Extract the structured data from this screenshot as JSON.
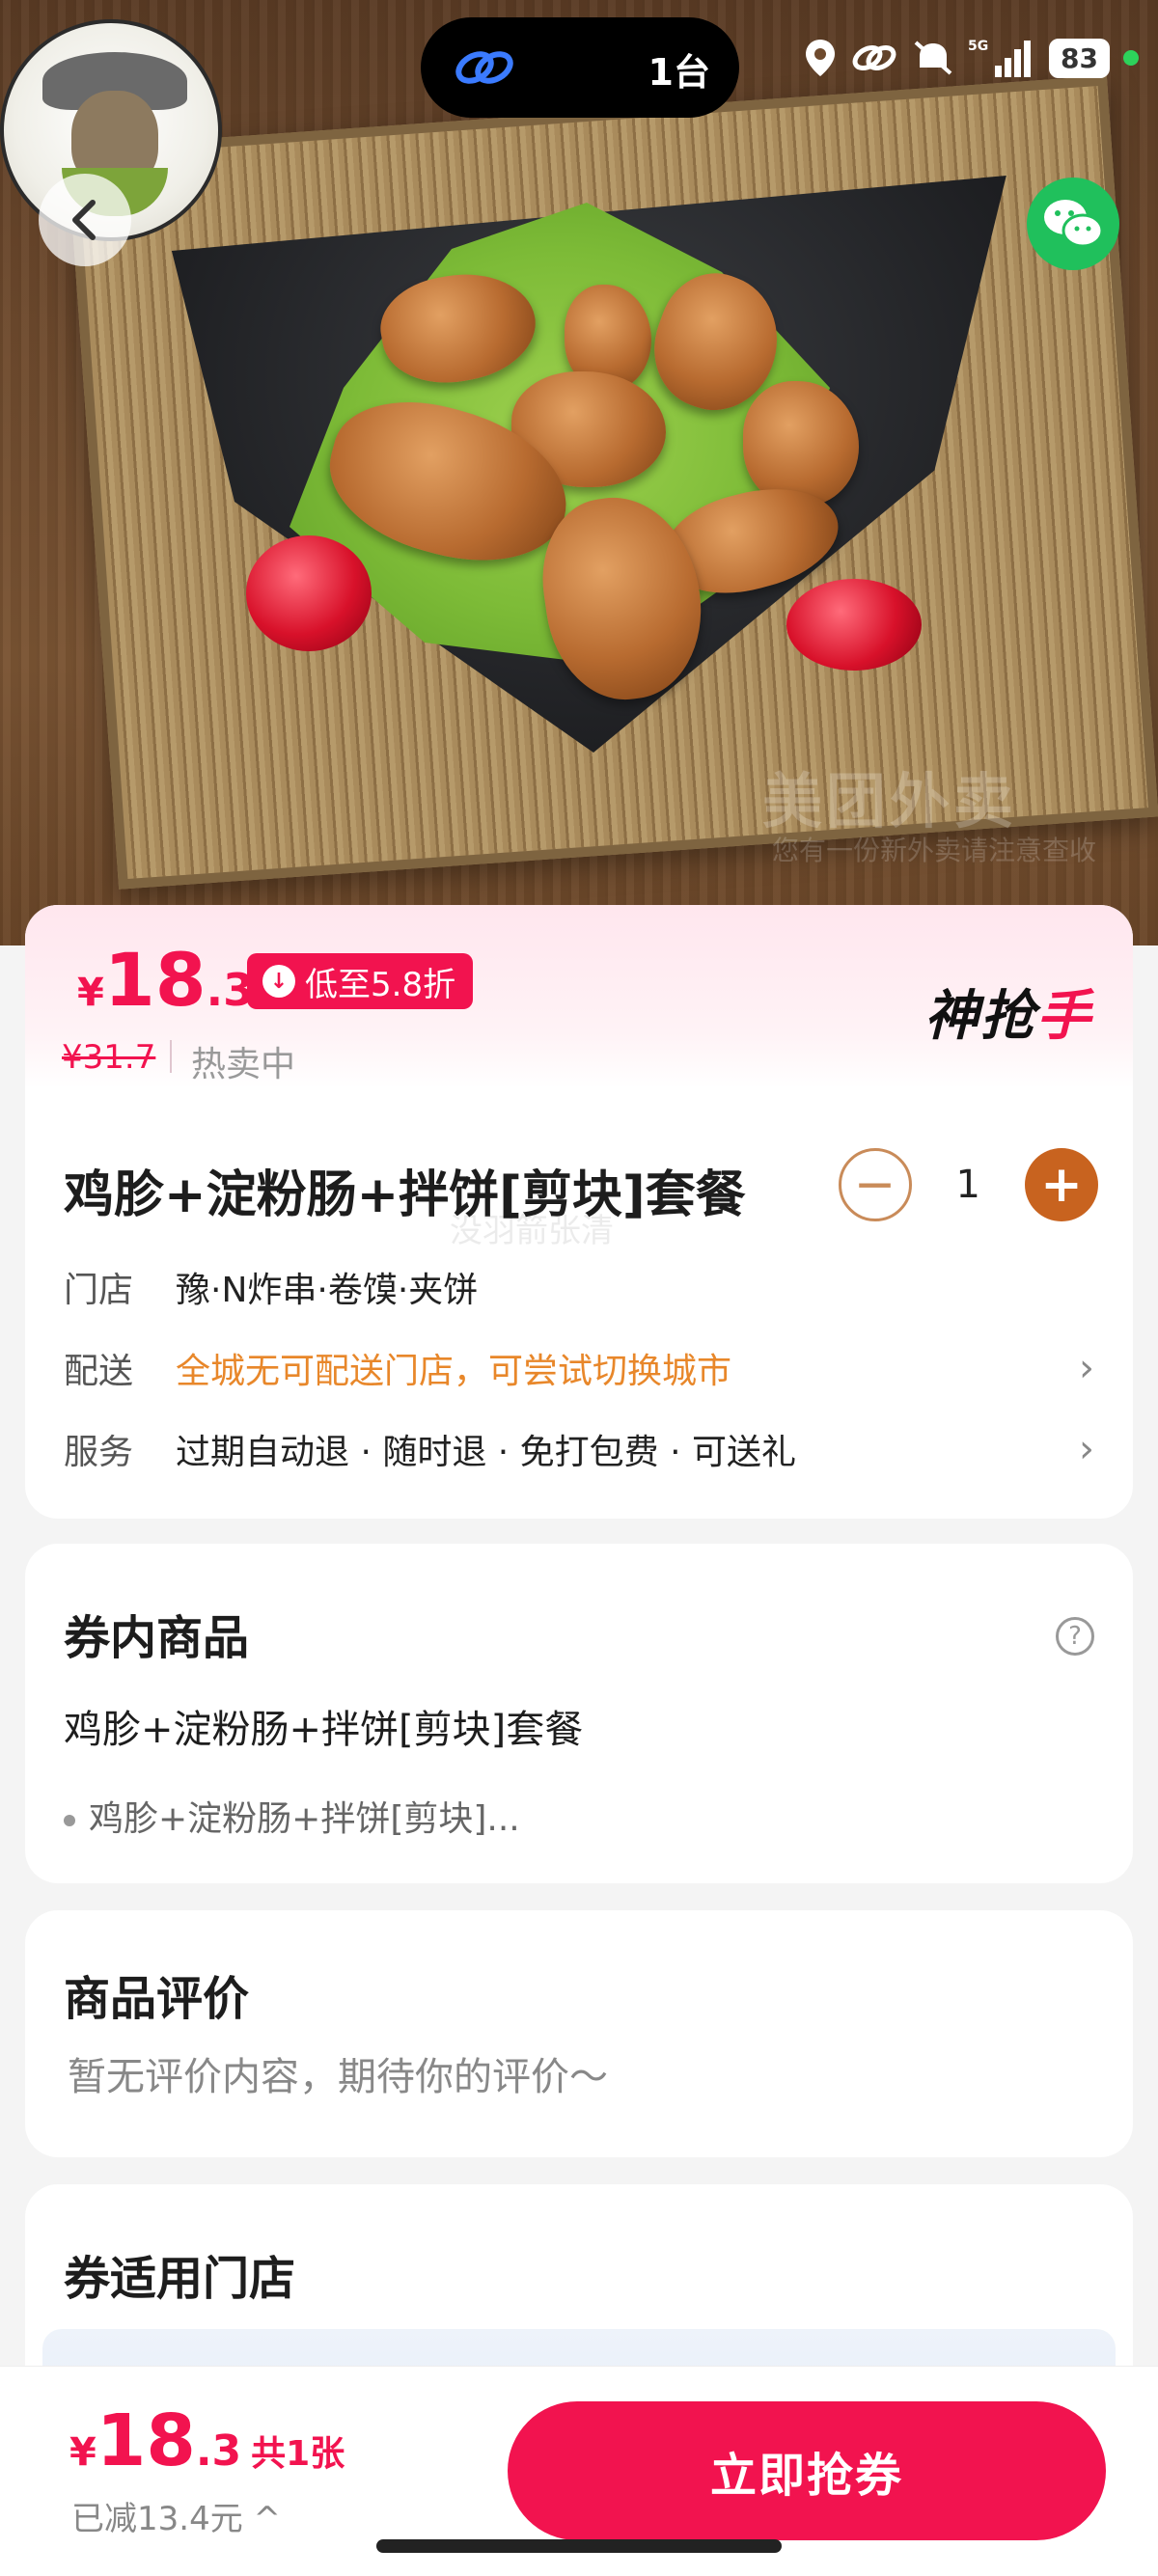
{
  "status_bar": {
    "island_text": "1台",
    "battery": "83"
  },
  "hero": {
    "watermark": "美团外卖",
    "watermark_sub": "您有一份新外卖请注意查收"
  },
  "price": {
    "currency": "¥",
    "current_int": "18",
    "current_dec": ".3",
    "discount_tag": "低至5.8折",
    "original": "¥31.7",
    "status": "热卖中",
    "brand_logo_a": "神抢",
    "brand_logo_b": "手"
  },
  "product": {
    "title": "鸡胗+淀粉肠+拌饼[剪块]套餐",
    "quantity": "1",
    "faint_watermark": "没羽箭张清",
    "store_label": "门店",
    "store_value": "豫·N炸串·卷馍·夹饼",
    "delivery_label": "配送",
    "delivery_value": "全城无可配送门店，可尝试切换城市",
    "service_label": "服务",
    "service_value": "过期自动退 · 随时退 · 免打包费 · 可送礼"
  },
  "voucher_items": {
    "title": "券内商品",
    "name": "鸡胗+淀粉肠+拌饼[剪块]套餐",
    "item": "鸡胗+淀粉肠+拌饼[剪块]..."
  },
  "reviews": {
    "title": "商品评价",
    "empty_text": "暂无评价内容，期待你的评价～"
  },
  "stores": {
    "title": "券适用门店"
  },
  "bottom_bar": {
    "currency": "¥",
    "price_int": "18",
    "price_dec": ".3",
    "count": "共1张",
    "saved": "已减13.4元 ^",
    "buy_label": "立即抢券"
  },
  "colors": {
    "accent": "#f2134f",
    "warning": "#e8872a",
    "stepper": "#c8631f",
    "wechat": "#20c05c"
  }
}
